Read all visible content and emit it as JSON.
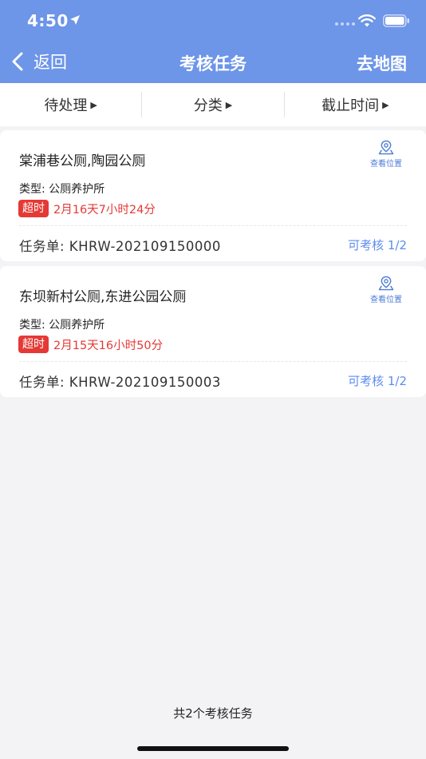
{
  "status_bar": {
    "time": "4:50",
    "icons": [
      "location-arrow-icon",
      "signal-icon",
      "wifi-icon",
      "battery-icon"
    ]
  },
  "nav": {
    "back_label": "返回",
    "title": "考核任务",
    "map_label": "去地图"
  },
  "filters": [
    {
      "label": "待处理"
    },
    {
      "label": "分类"
    },
    {
      "label": "截止时间"
    }
  ],
  "tasks": [
    {
      "title": "棠浦巷公厕,陶园公厕",
      "locate_label": "查看位置",
      "type": "类型: 公厕养护所",
      "overdue_badge": "超时",
      "overdue_time": "2月16天7小时24分",
      "task_no": "任务单: KHRW-202109150000",
      "assess": "可考核 1/2"
    },
    {
      "title": "东坝新村公厕,东进公园公厕",
      "locate_label": "查看位置",
      "type": "类型: 公厕养护所",
      "overdue_badge": "超时",
      "overdue_time": "2月15天16小时50分",
      "task_no": "任务单: KHRW-202109150003",
      "assess": "可考核 1/2"
    }
  ],
  "footer": {
    "summary": "共2个考核任务"
  },
  "colors": {
    "header_bg": "#6D95E8",
    "accent_blue": "#5B8DEF",
    "overdue_red": "#E53935",
    "page_bg": "#F3F3F6"
  }
}
